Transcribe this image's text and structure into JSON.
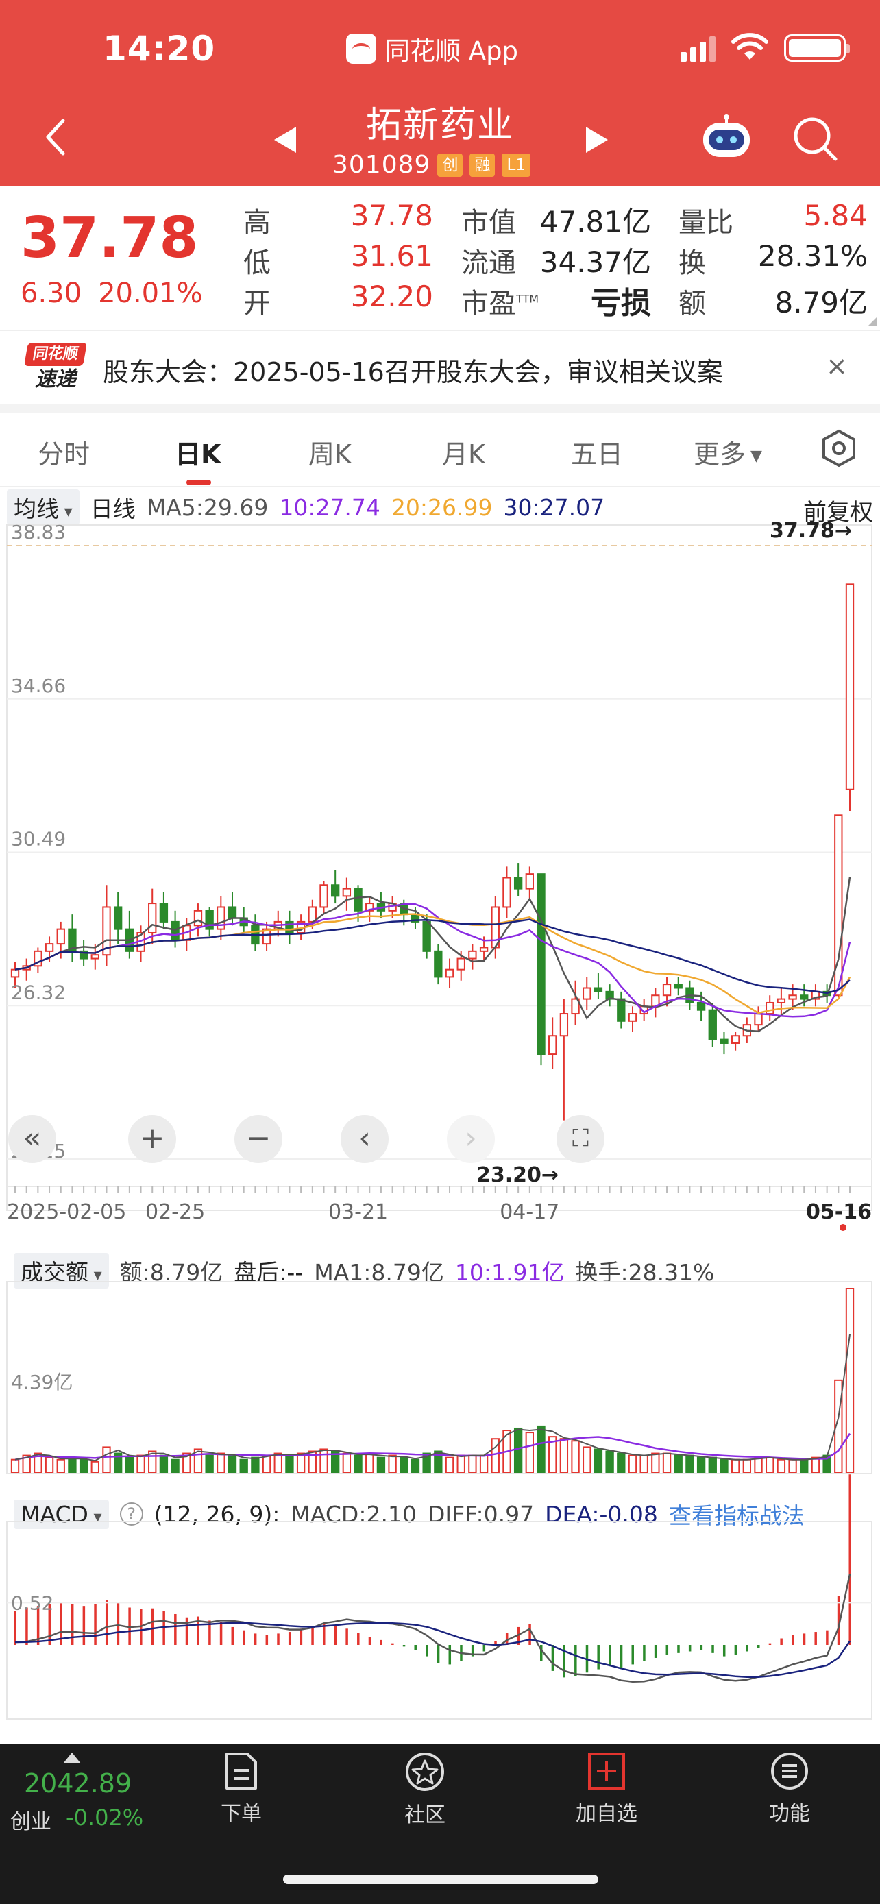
{
  "status_bar": {
    "time": "14:20",
    "app_name": "同花顺 App"
  },
  "header": {
    "stock_name": "拓新药业",
    "stock_code": "301089",
    "tags": [
      "创",
      "融",
      "L1"
    ]
  },
  "quote": {
    "price": "37.78",
    "change": "6.30",
    "change_pct": "20.01%",
    "fields": [
      {
        "label": "高",
        "value": "37.78"
      },
      {
        "label": "低",
        "value": "31.61"
      },
      {
        "label": "开",
        "value": "32.20"
      },
      {
        "label": "市值",
        "value": "47.81亿"
      },
      {
        "label": "流通",
        "value": "34.37亿"
      },
      {
        "label": "市盈",
        "suffix": "TTM",
        "value": "亏损"
      },
      {
        "label": "量比",
        "value": "5.84"
      },
      {
        "label": "换",
        "value": "28.31%"
      },
      {
        "label": "额",
        "value": "8.79亿"
      }
    ]
  },
  "notice": {
    "logo_top": "同花顺",
    "logo_bottom": "速递",
    "text": "股东大会：2025-05-16召开股东大会，审议相关议案",
    "close": "×"
  },
  "tabs": [
    {
      "label": "分时"
    },
    {
      "label": "日K"
    },
    {
      "label": "周K"
    },
    {
      "label": "月K"
    },
    {
      "label": "五日"
    },
    {
      "label": "更多"
    }
  ],
  "ma_row": {
    "dropdown": "均线",
    "period": "日线",
    "ma5": "MA5:29.69",
    "ma10": "10:27.74",
    "ma20": "20:26.99",
    "ma30": "30:27.07",
    "adjust": "前复权"
  },
  "colors": {
    "up": "#e3352f",
    "down": "#2b8a2b",
    "ma5": "#555555",
    "ma10": "#8a2be2",
    "ma20": "#f0a830",
    "ma30": "#1a237e",
    "header_bg": "#e54a43"
  },
  "kline": {
    "y_ticks": [
      "38.83",
      "34.66",
      "30.49",
      "26.32",
      "22.15"
    ],
    "y_range": [
      22.15,
      38.83
    ],
    "x_ticks": [
      "2025-02-05",
      "02-25",
      "03-21",
      "04-17",
      "05-16"
    ],
    "high_marker": "37.78→",
    "low_marker": "23.20→",
    "candles": [
      [
        27.1,
        27.5,
        26.8,
        27.3
      ],
      [
        27.3,
        27.6,
        27.0,
        27.4
      ],
      [
        27.4,
        27.9,
        27.2,
        27.8
      ],
      [
        27.8,
        28.2,
        27.5,
        28.0
      ],
      [
        28.0,
        28.6,
        27.6,
        28.4
      ],
      [
        28.4,
        28.8,
        27.5,
        27.8
      ],
      [
        27.8,
        28.1,
        27.4,
        27.6
      ],
      [
        27.6,
        28.0,
        27.3,
        27.7
      ],
      [
        27.7,
        29.6,
        27.4,
        29.0
      ],
      [
        29.0,
        29.4,
        28.0,
        28.4
      ],
      [
        28.4,
        28.9,
        27.6,
        27.8
      ],
      [
        27.8,
        28.5,
        27.5,
        28.3
      ],
      [
        28.3,
        29.5,
        28.0,
        29.1
      ],
      [
        29.1,
        29.4,
        28.4,
        28.6
      ],
      [
        28.6,
        28.9,
        27.9,
        28.1
      ],
      [
        28.1,
        28.7,
        27.8,
        28.5
      ],
      [
        28.5,
        29.1,
        28.2,
        28.9
      ],
      [
        28.9,
        29.0,
        28.2,
        28.4
      ],
      [
        28.4,
        29.3,
        28.1,
        29.0
      ],
      [
        29.0,
        29.4,
        28.5,
        28.7
      ],
      [
        28.7,
        29.0,
        28.3,
        28.5
      ],
      [
        28.5,
        28.8,
        27.8,
        28.0
      ],
      [
        28.0,
        28.6,
        27.8,
        28.4
      ],
      [
        28.4,
        28.9,
        28.2,
        28.6
      ],
      [
        28.6,
        28.9,
        28.0,
        28.3
      ],
      [
        28.3,
        28.8,
        28.1,
        28.6
      ],
      [
        28.6,
        29.2,
        28.4,
        29.0
      ],
      [
        29.0,
        29.7,
        28.8,
        29.6
      ],
      [
        29.6,
        30.0,
        29.1,
        29.3
      ],
      [
        29.3,
        29.8,
        28.9,
        29.5
      ],
      [
        29.5,
        29.6,
        28.6,
        28.9
      ],
      [
        28.9,
        29.3,
        28.6,
        29.1
      ],
      [
        29.1,
        29.4,
        28.7,
        28.9
      ],
      [
        28.9,
        29.3,
        28.7,
        29.1
      ],
      [
        29.1,
        29.2,
        28.5,
        28.8
      ],
      [
        28.8,
        29.0,
        28.4,
        28.6
      ],
      [
        28.6,
        28.8,
        27.6,
        27.8
      ],
      [
        27.8,
        28.0,
        26.9,
        27.1
      ],
      [
        27.1,
        27.6,
        26.8,
        27.3
      ],
      [
        27.3,
        27.8,
        27.0,
        27.6
      ],
      [
        27.6,
        28.0,
        27.3,
        27.8
      ],
      [
        27.8,
        28.2,
        27.5,
        27.9
      ],
      [
        27.9,
        29.3,
        27.6,
        29.0
      ],
      [
        29.0,
        30.1,
        28.7,
        29.8
      ],
      [
        29.8,
        30.2,
        29.3,
        29.5
      ],
      [
        29.5,
        30.1,
        29.2,
        29.9
      ],
      [
        29.9,
        29.9,
        24.7,
        25.0
      ],
      [
        25.0,
        26.0,
        24.6,
        25.5
      ],
      [
        25.5,
        26.5,
        23.2,
        26.1
      ],
      [
        26.1,
        27.0,
        25.8,
        26.5
      ],
      [
        26.5,
        27.1,
        26.2,
        26.8
      ],
      [
        26.8,
        27.2,
        26.5,
        26.7
      ],
      [
        26.7,
        26.9,
        26.3,
        26.5
      ],
      [
        26.5,
        26.7,
        25.7,
        25.9
      ],
      [
        25.9,
        26.3,
        25.6,
        26.1
      ],
      [
        26.1,
        26.5,
        25.9,
        26.3
      ],
      [
        26.3,
        26.8,
        26.0,
        26.6
      ],
      [
        26.6,
        27.1,
        26.3,
        26.9
      ],
      [
        26.9,
        27.1,
        26.6,
        26.8
      ],
      [
        26.8,
        27.0,
        26.2,
        26.4
      ],
      [
        26.4,
        26.7,
        25.9,
        26.2
      ],
      [
        26.2,
        26.4,
        25.2,
        25.4
      ],
      [
        25.4,
        25.6,
        25.0,
        25.3
      ],
      [
        25.3,
        25.6,
        25.1,
        25.5
      ],
      [
        25.5,
        26.0,
        25.3,
        25.8
      ],
      [
        25.8,
        26.3,
        25.6,
        26.1
      ],
      [
        26.1,
        26.6,
        25.9,
        26.4
      ],
      [
        26.4,
        26.8,
        26.1,
        26.5
      ],
      [
        26.5,
        26.9,
        26.2,
        26.6
      ],
      [
        26.6,
        26.9,
        26.3,
        26.5
      ],
      [
        26.5,
        26.9,
        26.3,
        26.7
      ],
      [
        26.7,
        26.9,
        26.4,
        26.6
      ],
      [
        26.6,
        31.5,
        26.5,
        31.5
      ],
      [
        32.2,
        37.78,
        31.61,
        37.78
      ]
    ]
  },
  "controls": {
    "rewind": "«",
    "zoom_in": "+",
    "zoom_out": "−",
    "prev": "‹",
    "next": "›",
    "fullscreen": "⛶"
  },
  "volume": {
    "dropdown": "成交额",
    "amount": "额:8.79亿",
    "after_hours": "盘后:--",
    "ma1": "MA1:8.79亿",
    "ma10": "10:1.91亿",
    "turnover": "换手:28.31%",
    "y_tick": "4.39亿",
    "y_max": 8.79,
    "values": [
      0.6,
      0.8,
      0.9,
      0.7,
      0.6,
      0.7,
      0.6,
      0.5,
      1.2,
      0.9,
      0.7,
      0.8,
      1.0,
      0.8,
      0.6,
      0.9,
      1.1,
      0.8,
      0.9,
      0.8,
      0.6,
      0.7,
      0.8,
      0.9,
      0.8,
      0.9,
      1.0,
      1.1,
      1.0,
      0.9,
      0.8,
      0.9,
      0.7,
      0.8,
      0.7,
      0.6,
      0.9,
      1.0,
      0.7,
      0.8,
      0.8,
      0.8,
      1.6,
      2.0,
      2.1,
      1.9,
      2.2,
      1.7,
      1.6,
      1.5,
      1.2,
      1.1,
      1.0,
      0.9,
      0.8,
      0.8,
      0.9,
      0.9,
      0.8,
      0.8,
      0.7,
      0.7,
      0.6,
      0.6,
      0.6,
      0.7,
      0.7,
      0.6,
      0.6,
      0.6,
      0.7,
      0.8,
      4.4,
      8.79
    ]
  },
  "macd": {
    "dropdown": "MACD",
    "help": "?",
    "params": "(12, 26, 9):",
    "macd": "MACD:2.10",
    "diff": "DIFF:0.97",
    "dea": "DEA:-0.08",
    "link": "查看指标战法",
    "y_tick": "0.52",
    "hist": [
      0.42,
      0.46,
      0.48,
      0.5,
      0.52,
      0.5,
      0.48,
      0.5,
      0.55,
      0.52,
      0.46,
      0.44,
      0.45,
      0.42,
      0.38,
      0.34,
      0.35,
      0.3,
      0.28,
      0.22,
      0.18,
      0.14,
      0.12,
      0.14,
      0.16,
      0.2,
      0.22,
      0.26,
      0.24,
      0.2,
      0.15,
      0.1,
      0.06,
      0.02,
      -0.02,
      -0.06,
      -0.14,
      -0.22,
      -0.24,
      -0.2,
      -0.14,
      -0.08,
      0.05,
      0.15,
      0.22,
      0.26,
      -0.2,
      -0.32,
      -0.4,
      -0.38,
      -0.34,
      -0.3,
      -0.26,
      -0.28,
      -0.24,
      -0.2,
      -0.16,
      -0.12,
      -0.1,
      -0.08,
      -0.06,
      -0.1,
      -0.14,
      -0.12,
      -0.08,
      -0.04,
      0.02,
      0.08,
      0.12,
      0.14,
      0.16,
      0.18,
      0.6,
      2.1
    ]
  },
  "bottom_nav": {
    "index_value": "2042.89",
    "index_name": "创业",
    "index_change": "-0.02%",
    "items": [
      {
        "label": "下单",
        "icon": "order-icon"
      },
      {
        "label": "社区",
        "icon": "community-icon"
      },
      {
        "label": "加自选",
        "icon": "add-watchlist-icon"
      },
      {
        "label": "功能",
        "icon": "menu-icon"
      }
    ]
  }
}
